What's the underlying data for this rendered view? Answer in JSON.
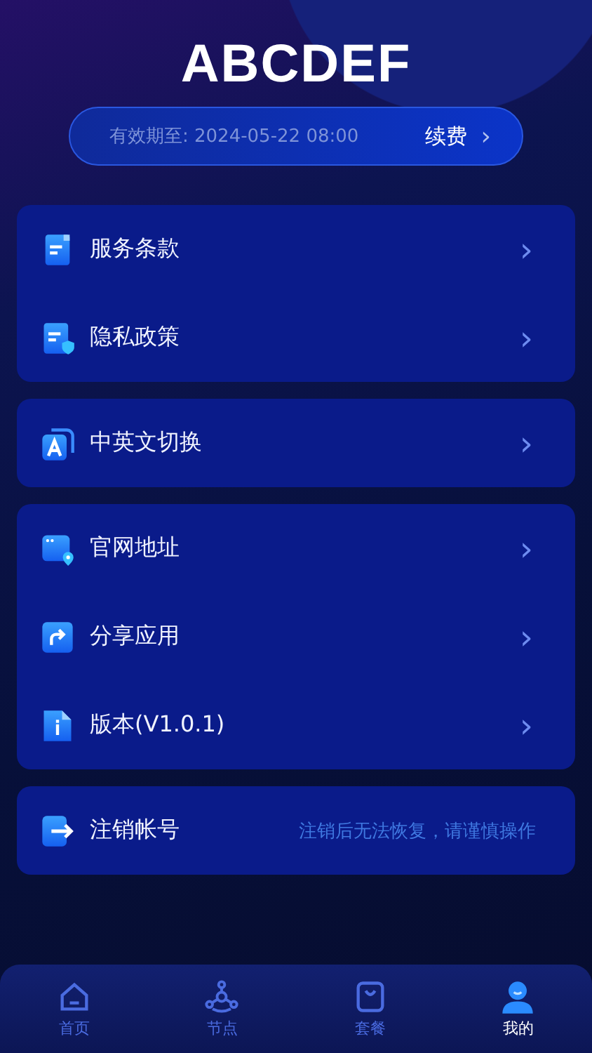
{
  "app_title": "ABCDEF",
  "membership": {
    "expiry": "有效期至: 2024-05-22 08:00",
    "renew_label": "续费",
    "renew_chevron": "›"
  },
  "groups": [
    {
      "items": [
        {
          "kind": "document",
          "label": "服务条款",
          "chevron": "›"
        },
        {
          "kind": "document-shield",
          "label": "隐私政策",
          "chevron": "›"
        }
      ]
    },
    {
      "items": [
        {
          "kind": "letter",
          "label": "中英文切换",
          "chevron": "›"
        }
      ]
    },
    {
      "items": [
        {
          "kind": "browser-pin",
          "label": "官网地址",
          "chevron": "›"
        },
        {
          "kind": "share",
          "label": "分享应用",
          "chevron": "›"
        },
        {
          "kind": "info",
          "label": "版本(V1.0.1)",
          "chevron": "›"
        }
      ]
    },
    {
      "items": [
        {
          "kind": "exit",
          "label": "注销帐号",
          "note": "注销后无法恢复，请谨慎操作"
        }
      ]
    }
  ],
  "tab_bar": [
    {
      "kind": "home",
      "label": "首页",
      "selected": false
    },
    {
      "kind": "nodes",
      "label": "节点",
      "selected": false
    },
    {
      "kind": "bag",
      "label": "套餐",
      "selected": false
    },
    {
      "kind": "user",
      "label": "我的",
      "selected": true
    }
  ]
}
